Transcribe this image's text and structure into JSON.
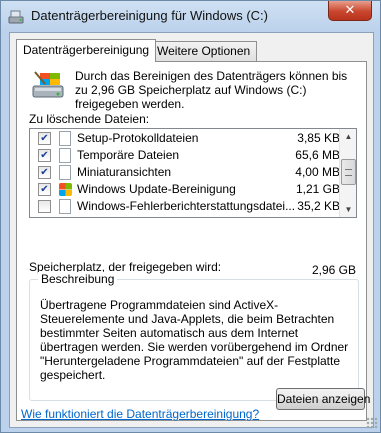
{
  "window": {
    "title": "Datenträgerbereinigung für Windows (C:)",
    "close_label": "✕"
  },
  "tabs": [
    {
      "label": "Datenträgerbereinigung",
      "active": true
    },
    {
      "label": "Weitere Optionen",
      "active": false
    }
  ],
  "intro_text": "Durch das Bereinigen des Datenträgers können bis zu 2,96 GB Speicherplatz auf Windows (C:) freigegeben werden.",
  "files_label": "Zu löschende Dateien:",
  "files": [
    {
      "name": "Setup-Protokolldateien",
      "size": "3,85 KB",
      "checked": true,
      "icon": "file-icon"
    },
    {
      "name": "Temporäre Dateien",
      "size": "65,6 MB",
      "checked": true,
      "icon": "file-icon"
    },
    {
      "name": "Miniaturansichten",
      "size": "4,00 MB",
      "checked": true,
      "icon": "file-icon"
    },
    {
      "name": "Windows Update-Bereinigung",
      "size": "1,21 GB",
      "checked": true,
      "icon": "windows-icon"
    },
    {
      "name": "Windows-Fehlerberichterstattungsdatei...",
      "size": "35,2 KB",
      "checked": false,
      "icon": "file-icon"
    }
  ],
  "freed": {
    "label": "Speicherplatz, der freigegeben wird:",
    "value": "2,96 GB"
  },
  "description": {
    "title": "Beschreibung",
    "text": "Übertragene Programmdateien sind ActiveX-Steuerelemente und Java-Applets, die beim Betrachten bestimmter Seiten automatisch aus dem Internet übertragen werden. Sie werden vorübergehend im Ordner \"Heruntergeladene Programmdateien\" auf der Festplatte gespeichert."
  },
  "view_files_button": "Dateien anzeigen",
  "help_link": "Wie funktioniert die Datenträgerbereinigung?",
  "colors": {
    "link": "#0066cc",
    "close": "#c9462d",
    "frame": "#bcd2ec"
  }
}
